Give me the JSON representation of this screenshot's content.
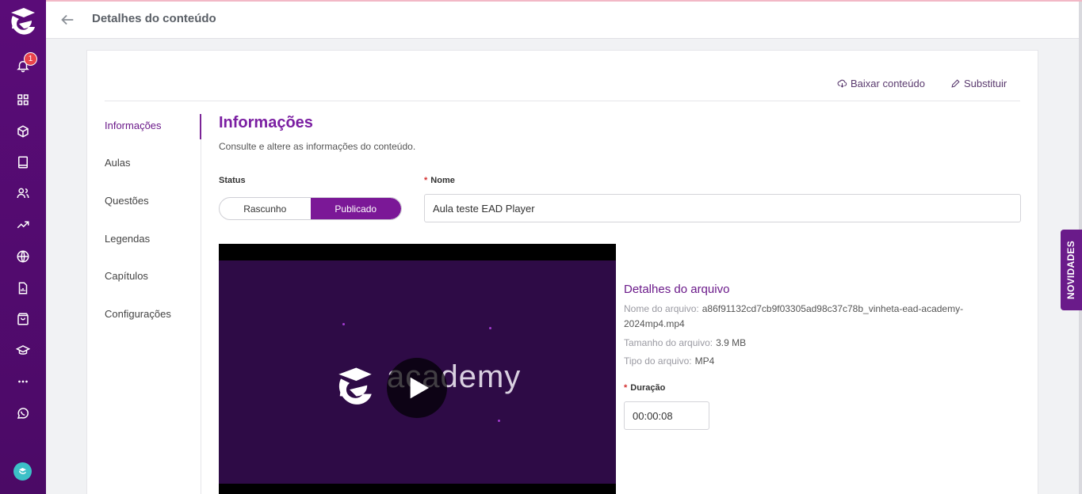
{
  "header": {
    "title": "Detalhes do conteúdo"
  },
  "sidebar": {
    "notification_count": "1"
  },
  "actions": {
    "download": "Baixar conteúdo",
    "replace": "Substituir"
  },
  "tabs": [
    {
      "label": "Informações"
    },
    {
      "label": "Aulas"
    },
    {
      "label": "Questões"
    },
    {
      "label": "Legendas"
    },
    {
      "label": "Capítulos"
    },
    {
      "label": "Configurações"
    }
  ],
  "section": {
    "title": "Informações",
    "subtitle": "Consulte e altere as informações do conteúdo."
  },
  "status": {
    "label": "Status",
    "options": [
      "Rascunho",
      "Publicado"
    ],
    "selected": "Publicado"
  },
  "name": {
    "label": "Nome",
    "value": "Aula teste EAD Player"
  },
  "video": {
    "brand_text": "academy"
  },
  "file_details": {
    "title": "Detalhes do arquivo",
    "name_label": "Nome do arquivo:",
    "name_value": "a86f91132cd7cb9f03305ad98c37c78b_vinheta-ead-academy-2024mp4.mp4",
    "size_label": "Tamanho do arquivo:",
    "size_value": "3.9 MB",
    "type_label": "Tipo do arquivo:",
    "type_value": "MP4"
  },
  "duration": {
    "label": "Duração",
    "value": "00:00:08"
  },
  "novidades": {
    "label": "NOVIDADES"
  },
  "colors": {
    "brand": "#6b1a8a",
    "sidebar": "#5a0c78",
    "badge": "#e8434b"
  }
}
